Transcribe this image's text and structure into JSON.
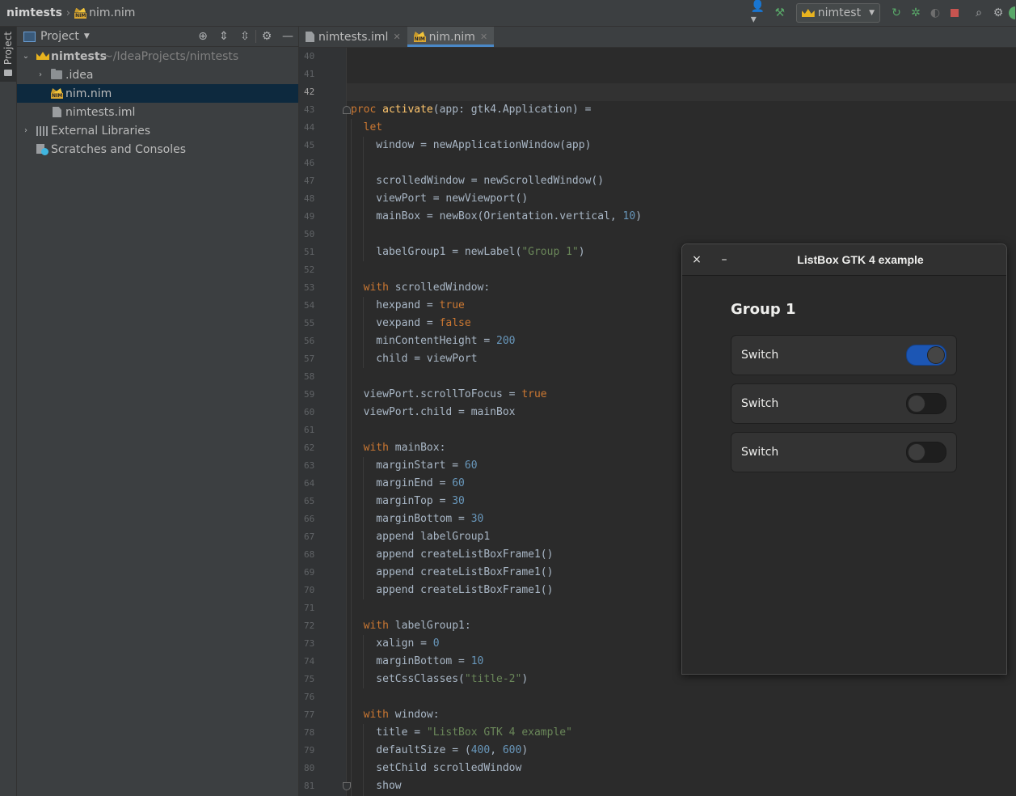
{
  "navbar": {
    "project_name": "nimtests",
    "separator": "›",
    "current_file": "nim.nim",
    "run_config": "nimtest"
  },
  "tool_stripe": {
    "project_label": "Project"
  },
  "project_panel": {
    "title": "Project",
    "root": {
      "name": "nimtests",
      "path": "~/IdeaProjects/nimtests"
    },
    "items": [
      {
        "label": ".idea",
        "kind": "folder"
      },
      {
        "label": "nim.nim",
        "kind": "nim-file",
        "selected": true
      },
      {
        "label": "nimtests.iml",
        "kind": "iml-file"
      },
      {
        "label": "External Libraries",
        "kind": "libraries"
      },
      {
        "label": "Scratches and Consoles",
        "kind": "scratches"
      }
    ]
  },
  "editor": {
    "tabs": [
      {
        "label": "nimtests.iml",
        "active": false
      },
      {
        "label": "nim.nim",
        "active": true
      }
    ],
    "current_line": 42,
    "line_numbers": [
      "40",
      "41",
      "42",
      "43",
      "44",
      "45",
      "46",
      "47",
      "48",
      "49",
      "50",
      "51",
      "52",
      "53",
      "54",
      "55",
      "56",
      "57",
      "58",
      "59",
      "60",
      "61",
      "62",
      "63",
      "64",
      "65",
      "66",
      "67",
      "68",
      "69",
      "70",
      "71",
      "72",
      "73",
      "74",
      "75",
      "76",
      "77",
      "78",
      "79",
      "80",
      "81"
    ],
    "code": [
      "",
      "",
      "",
      "proc activate(app: gtk4.Application) =",
      "  let",
      "    window = newApplicationWindow(app)",
      "",
      "    scrolledWindow = newScrolledWindow()",
      "    viewPort = newViewport()",
      "    mainBox = newBox(Orientation.vertical, 10)",
      "",
      "    labelGroup1 = newLabel(\"Group 1\")",
      "",
      "  with scrolledWindow:",
      "    hexpand = true",
      "    vexpand = false",
      "    minContentHeight = 200",
      "    child = viewPort",
      "",
      "  viewPort.scrollToFocus = true",
      "  viewPort.child = mainBox",
      "",
      "  with mainBox:",
      "    marginStart = 60",
      "    marginEnd = 60",
      "    marginTop = 30",
      "    marginBottom = 30",
      "    append labelGroup1",
      "    append createListBoxFrame1()",
      "    append createListBoxFrame1()",
      "    append createListBoxFrame1()",
      "",
      "  with labelGroup1:",
      "    xalign = 0",
      "    marginBottom = 10",
      "    setCssClasses(\"title-2\")",
      "",
      "  with window:",
      "    title = \"ListBox GTK 4 example\"",
      "    defaultSize = (400, 600)",
      "    setChild scrolledWindow",
      "    show"
    ]
  },
  "gtk_window": {
    "title": "ListBox GTK 4 example",
    "close_glyph": "×",
    "minimize_glyph": "–",
    "group_title": "Group 1",
    "rows": [
      {
        "label": "Switch",
        "on": true
      },
      {
        "label": "Switch",
        "on": false
      },
      {
        "label": "Switch",
        "on": false
      }
    ]
  },
  "colors": {
    "keyword": "#cc7832",
    "function": "#ffc66d",
    "number": "#6897bb",
    "string": "#6a8759",
    "switch_on": "#1c56b4"
  }
}
